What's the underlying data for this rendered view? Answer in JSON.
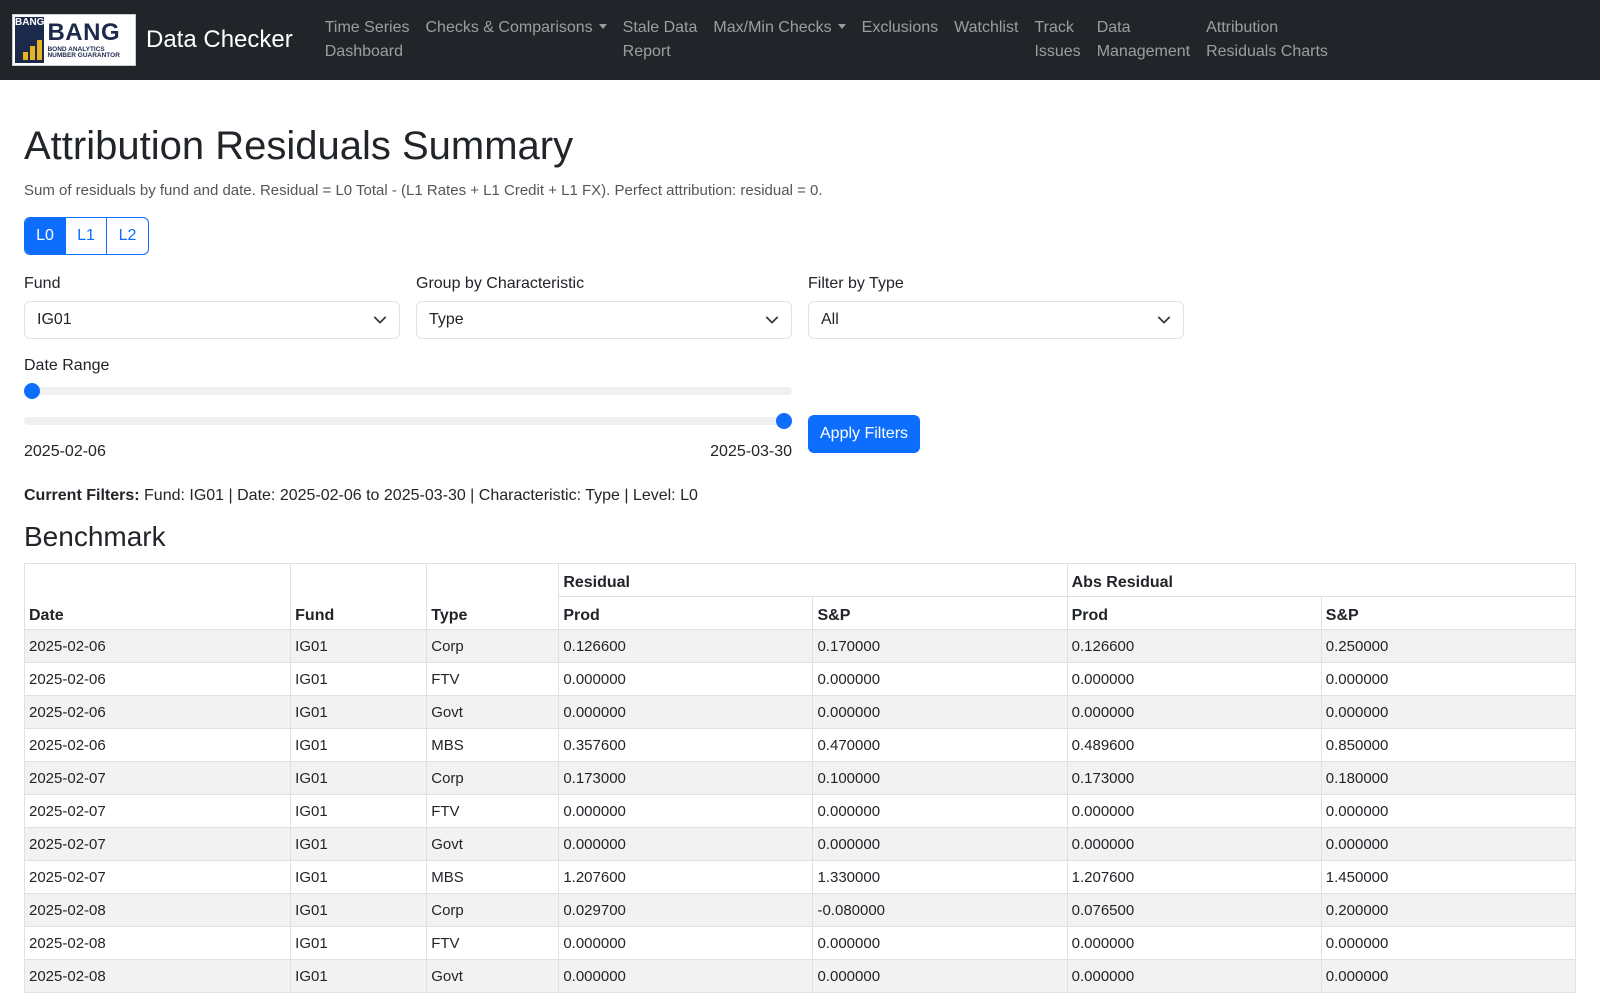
{
  "nav": {
    "logo_badge": "BANG",
    "logo_title": "BANG",
    "logo_tagline": "BOND ANALYTICS NUMBER GUARANTOR",
    "brand": "Data Checker",
    "items": [
      {
        "label": "Time Series\nDashboard",
        "dropdown": false
      },
      {
        "label": "Checks & Comparisons",
        "dropdown": true
      },
      {
        "label": "Stale Data\nReport",
        "dropdown": false
      },
      {
        "label": "Max/Min Checks",
        "dropdown": true
      },
      {
        "label": "Exclusions",
        "dropdown": false
      },
      {
        "label": "Watchlist",
        "dropdown": false
      },
      {
        "label": "Track\nIssues",
        "dropdown": false
      },
      {
        "label": "Data\nManagement",
        "dropdown": false
      },
      {
        "label": "Attribution\nResiduals Charts",
        "dropdown": false
      }
    ]
  },
  "page": {
    "title": "Attribution Residuals Summary",
    "subtitle": "Sum of residuals by fund and date. Residual = L0 Total - (L1 Rates + L1 Credit + L1 FX). Perfect attribution: residual = 0.",
    "levels": [
      "L0",
      "L1",
      "L2"
    ],
    "active_level": "L0"
  },
  "filters": {
    "fund_label": "Fund",
    "fund_value": "IG01",
    "group_label": "Group by Characteristic",
    "group_value": "Type",
    "type_label": "Filter by Type",
    "type_value": "All",
    "date_label": "Date Range",
    "date_start": "2025-02-06",
    "date_end": "2025-03-30",
    "slider_start_fraction": 0,
    "slider_end_fraction": 1,
    "apply_label": "Apply Filters"
  },
  "current_filters": {
    "label": "Current Filters:",
    "text": "Fund: IG01 | Date: 2025-02-06 to 2025-03-30 | Characteristic: Type | Level: L0"
  },
  "section_title": "Benchmark",
  "table": {
    "group_headers": [
      "Residual",
      "Abs Residual"
    ],
    "headers": [
      "Date",
      "Fund",
      "Type",
      "Prod",
      "S&P",
      "Prod",
      "S&P"
    ],
    "rows": [
      [
        "2025-02-06",
        "IG01",
        "Corp",
        "0.126600",
        "0.170000",
        "0.126600",
        "0.250000"
      ],
      [
        "2025-02-06",
        "IG01",
        "FTV",
        "0.000000",
        "0.000000",
        "0.000000",
        "0.000000"
      ],
      [
        "2025-02-06",
        "IG01",
        "Govt",
        "0.000000",
        "0.000000",
        "0.000000",
        "0.000000"
      ],
      [
        "2025-02-06",
        "IG01",
        "MBS",
        "0.357600",
        "0.470000",
        "0.489600",
        "0.850000"
      ],
      [
        "2025-02-07",
        "IG01",
        "Corp",
        "0.173000",
        "0.100000",
        "0.173000",
        "0.180000"
      ],
      [
        "2025-02-07",
        "IG01",
        "FTV",
        "0.000000",
        "0.000000",
        "0.000000",
        "0.000000"
      ],
      [
        "2025-02-07",
        "IG01",
        "Govt",
        "0.000000",
        "0.000000",
        "0.000000",
        "0.000000"
      ],
      [
        "2025-02-07",
        "IG01",
        "MBS",
        "1.207600",
        "1.330000",
        "1.207600",
        "1.450000"
      ],
      [
        "2025-02-08",
        "IG01",
        "Corp",
        "0.029700",
        "-0.080000",
        "0.076500",
        "0.200000"
      ],
      [
        "2025-02-08",
        "IG01",
        "FTV",
        "0.000000",
        "0.000000",
        "0.000000",
        "0.000000"
      ],
      [
        "2025-02-08",
        "IG01",
        "Govt",
        "0.000000",
        "0.000000",
        "0.000000",
        "0.000000"
      ]
    ]
  },
  "colors": {
    "navbar": "#212529",
    "primary": "#0d6efd",
    "stripe": "#f2f2f2"
  }
}
